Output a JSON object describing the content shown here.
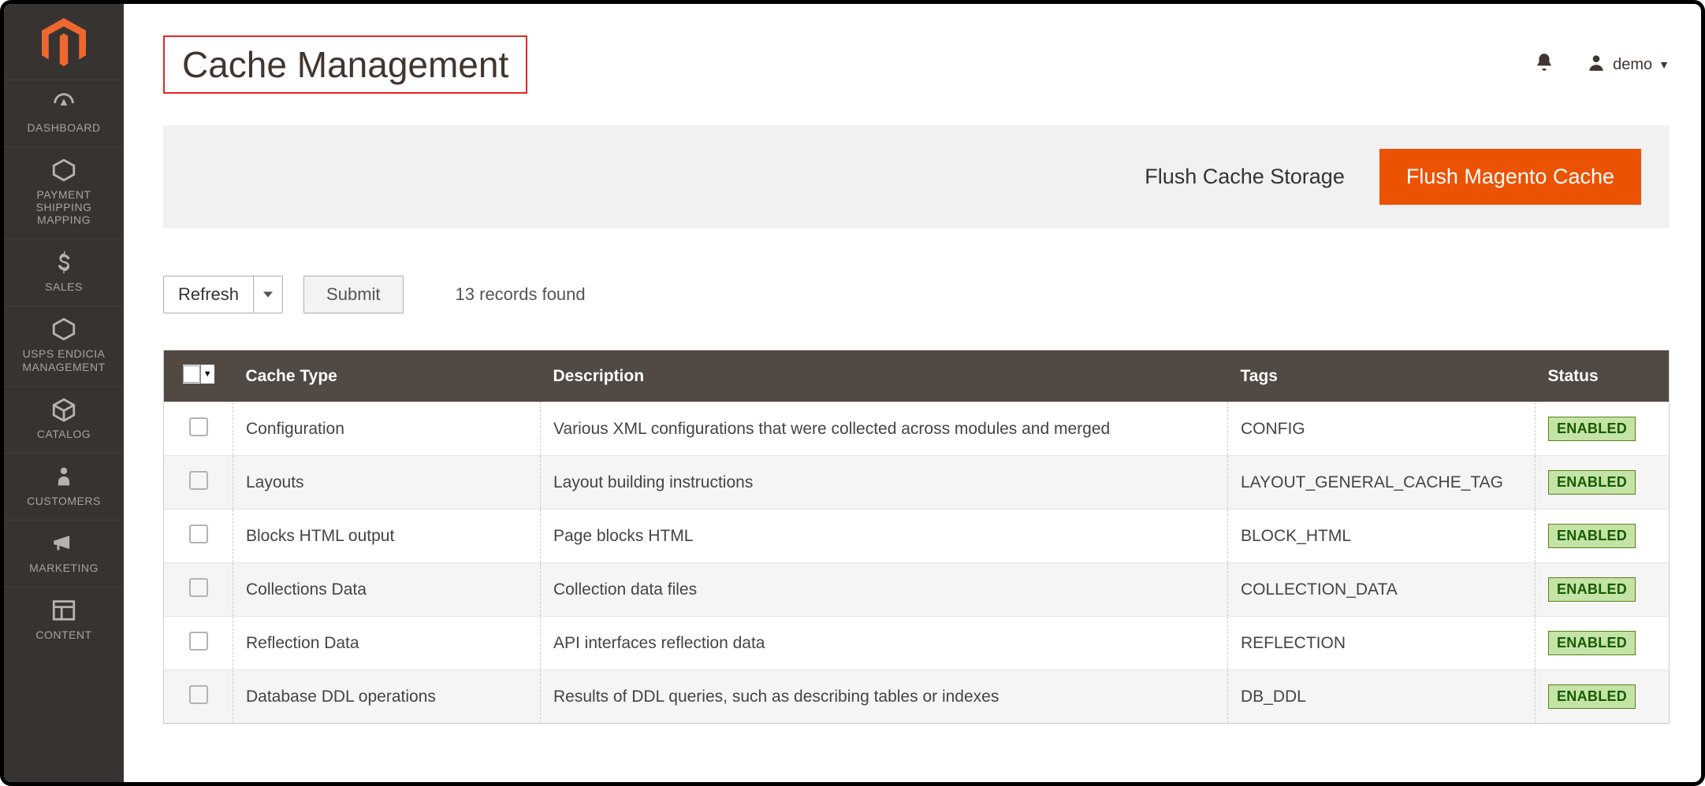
{
  "sidebar": {
    "items": [
      {
        "label": "DASHBOARD"
      },
      {
        "label": "PAYMENT SHIPPING MAPPING"
      },
      {
        "label": "SALES"
      },
      {
        "label": "USPS ENDICIA MANAGEMENT"
      },
      {
        "label": "CATALOG"
      },
      {
        "label": "CUSTOMERS"
      },
      {
        "label": "MARKETING"
      },
      {
        "label": "CONTENT"
      }
    ]
  },
  "header": {
    "title": "Cache Management",
    "user": "demo"
  },
  "actions": {
    "flush_storage": "Flush Cache Storage",
    "flush_magento": "Flush Magento Cache"
  },
  "toolbar": {
    "dropdown_selected": "Refresh",
    "submit": "Submit",
    "records_found": "13 records found"
  },
  "table": {
    "headers": {
      "cache_type": "Cache Type",
      "description": "Description",
      "tags": "Tags",
      "status": "Status"
    },
    "rows": [
      {
        "type": "Configuration",
        "desc": "Various XML configurations that were collected across modules and merged",
        "tags": "CONFIG",
        "status": "ENABLED"
      },
      {
        "type": "Layouts",
        "desc": "Layout building instructions",
        "tags": "LAYOUT_GENERAL_CACHE_TAG",
        "status": "ENABLED"
      },
      {
        "type": "Blocks HTML output",
        "desc": "Page blocks HTML",
        "tags": "BLOCK_HTML",
        "status": "ENABLED"
      },
      {
        "type": "Collections Data",
        "desc": "Collection data files",
        "tags": "COLLECTION_DATA",
        "status": "ENABLED"
      },
      {
        "type": "Reflection Data",
        "desc": "API interfaces reflection data",
        "tags": "REFLECTION",
        "status": "ENABLED"
      },
      {
        "type": "Database DDL operations",
        "desc": "Results of DDL queries, such as describing tables or indexes",
        "tags": "DB_DDL",
        "status": "ENABLED"
      }
    ]
  }
}
